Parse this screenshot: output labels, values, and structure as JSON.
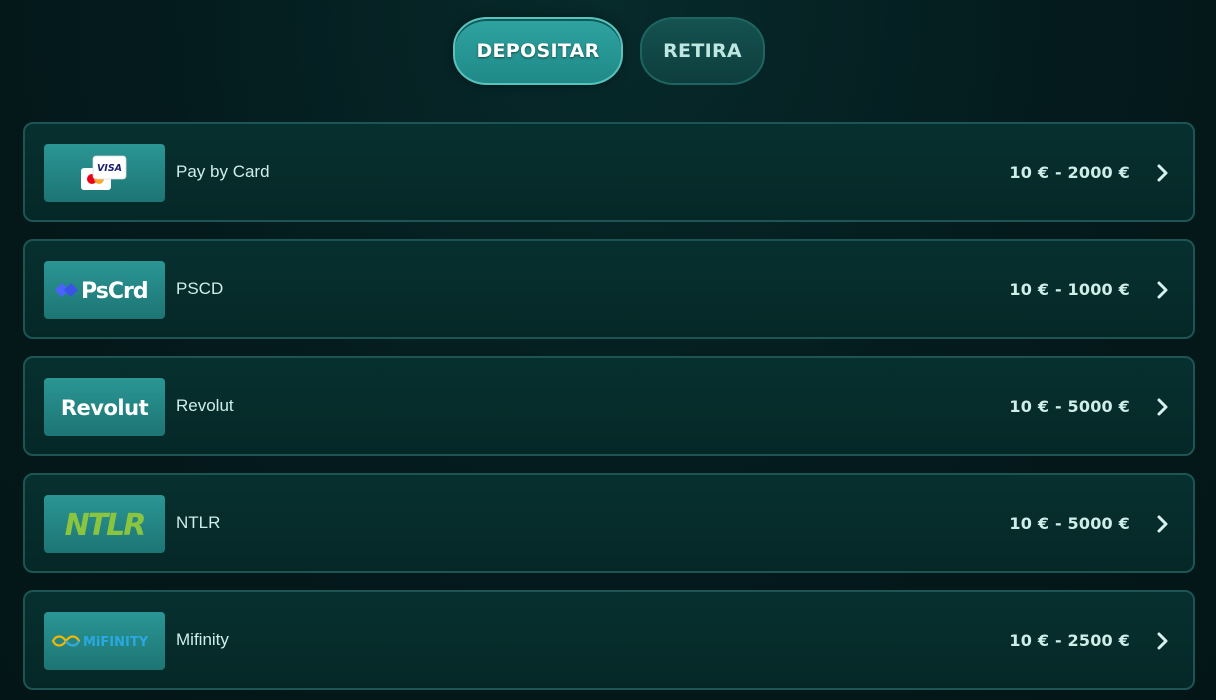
{
  "tabs": {
    "deposit_label": "DEPOSITAR",
    "withdraw_label": "RETIRA"
  },
  "methods": [
    {
      "name": "Pay by Card",
      "range": "10 € - 2000 €",
      "logo": "card-logo-icon",
      "logo_text": "VISA"
    },
    {
      "name": "PSCD",
      "range": "10 € - 1000 €",
      "logo": "pscrd-logo-icon",
      "logo_text": "PsCrd"
    },
    {
      "name": "Revolut",
      "range": "10 € - 5000 €",
      "logo": "revolut-logo-icon",
      "logo_text": "Revolut"
    },
    {
      "name": "NTLR",
      "range": "10 € - 5000 €",
      "logo": "ntlr-logo-icon",
      "logo_text": "NTLR"
    },
    {
      "name": "Mifinity",
      "range": "10 € - 2500 €",
      "logo": "mifinity-logo-icon",
      "logo_text": "MiFINITY"
    }
  ],
  "colors": {
    "background": "#041a1c",
    "accent": "#2fa3a0",
    "ntlr_green": "#8bc540",
    "pscrd_blue": "#4a63ff",
    "mifinity_blue": "#2aa8e0"
  }
}
